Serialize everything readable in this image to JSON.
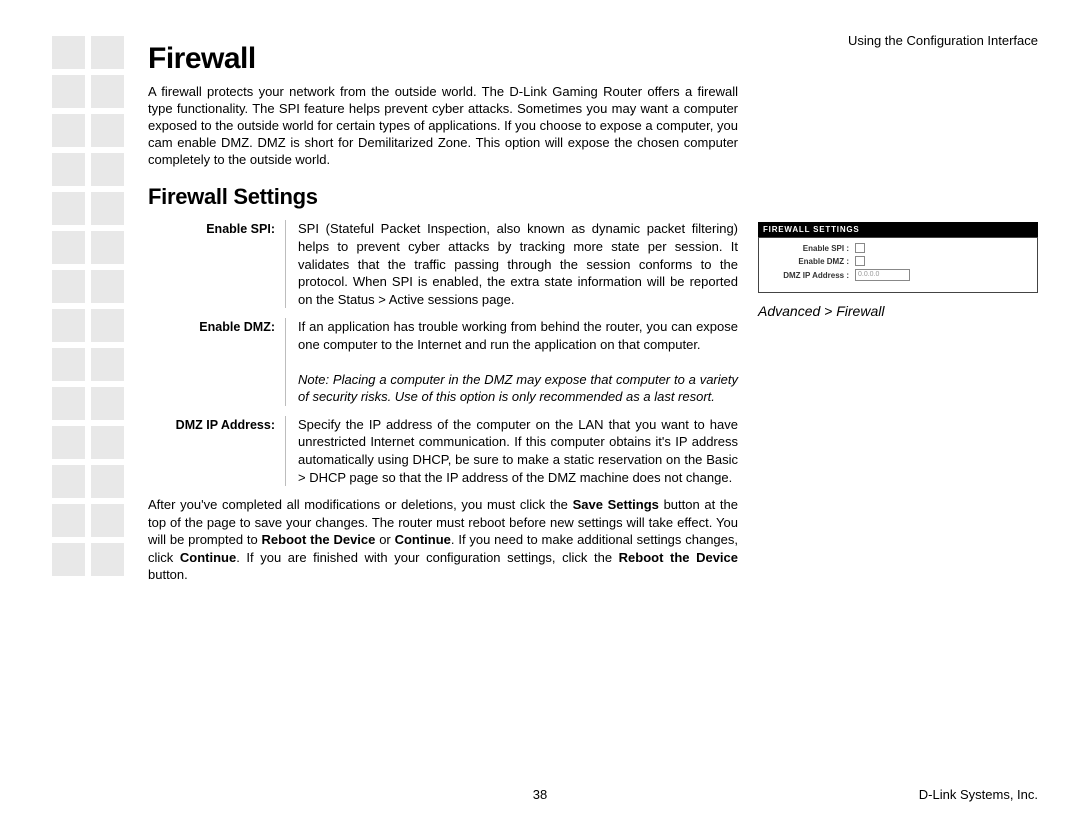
{
  "header": {
    "right": "Using the Configuration Interface"
  },
  "title": "Firewall",
  "intro": "A firewall protects your network from the outside world. The D-Link Gaming Router offers a firewall type functionality. The SPI feature helps prevent cyber attacks. Sometimes you may want a computer exposed to the outside world for certain types of applications. If you choose to expose a computer, you cam enable DMZ. DMZ is short for Demilitarized Zone. This option will expose the chosen computer completely to the outside world.",
  "section_title": "Firewall Settings",
  "settings": [
    {
      "label": "Enable SPI:",
      "desc": "SPI (Stateful Packet Inspection, also known as dynamic packet filtering) helps to prevent cyber attacks by tracking more state per session. It validates that the traffic passing through the session conforms to the protocol. When SPI is enabled, the extra state information will be reported on the Status > Active sessions page."
    },
    {
      "label": "Enable DMZ:",
      "desc": "If an application has trouble working from behind the router, you can expose one computer to the Internet and run the application on that computer.",
      "note": "Note: Placing a computer in the DMZ may expose that computer to a variety of security risks. Use of this option is only recommended as a last resort."
    },
    {
      "label": "DMZ IP Address:",
      "desc": "Specify the IP address of the computer on the LAN that you want to have unrestricted Internet communication. If this computer obtains it's IP address automatically using DHCP, be sure to make a static reservation on the Basic > DHCP page so that the IP address of the DMZ machine does not change."
    }
  ],
  "closing": {
    "pre1": "After you've completed all modifications or deletions, you must click the ",
    "b1": "Save Settings",
    "mid1": " button at the top of the page to save your changes. The router must reboot before new settings will take effect. You will be prompted to ",
    "b2": "Reboot the Device",
    "mid2": " or ",
    "b3": "Continue",
    "mid3": ". If you need to make additional settings changes, click ",
    "b4": "Continue",
    "mid4": ". If you are finished with your configuration settings, click the ",
    "b5": "Reboot the Device",
    "post": " button."
  },
  "screenshot": {
    "header": "FIREWALL SETTINGS",
    "rows": [
      {
        "label": "Enable SPI :",
        "type": "checkbox"
      },
      {
        "label": "Enable DMZ :",
        "type": "checkbox"
      },
      {
        "label": "DMZ IP Address :",
        "type": "input",
        "value": "0.0.0.0"
      }
    ],
    "caption": "Advanced > Firewall"
  },
  "page_number": "38",
  "company": "D-Link Systems, Inc."
}
